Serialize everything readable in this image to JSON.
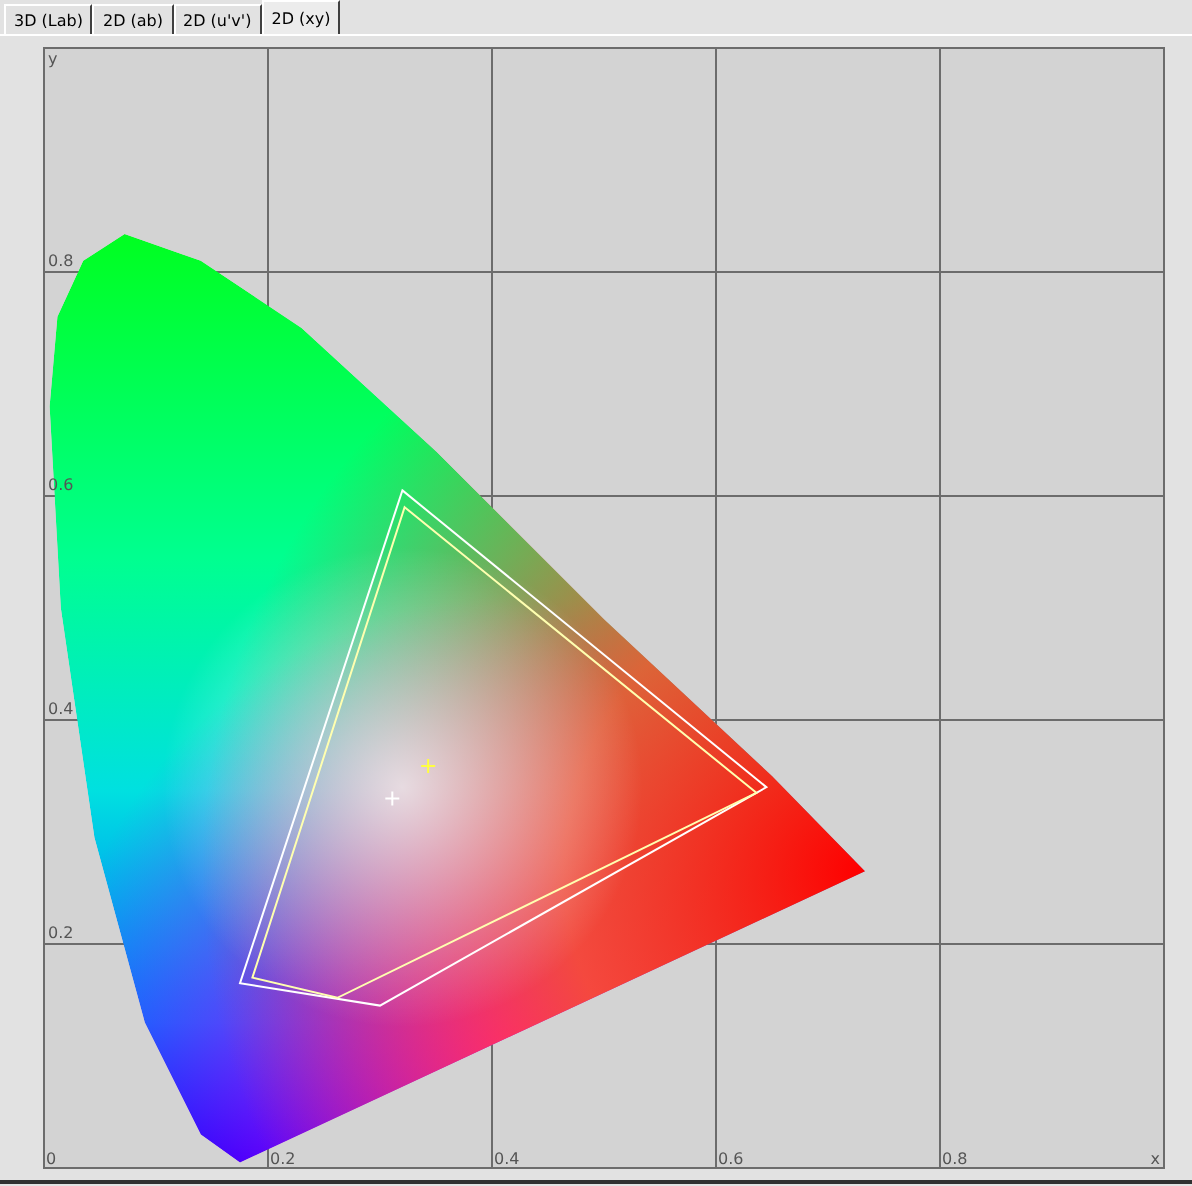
{
  "tabs": [
    {
      "label": "3D (Lab)",
      "selected": false
    },
    {
      "label": "2D (ab)",
      "selected": false
    },
    {
      "label": "2D (u'v')",
      "selected": false
    },
    {
      "label": "2D (xy)",
      "selected": true
    }
  ],
  "plot": {
    "x_axis_label": "x",
    "y_axis_label": "y",
    "x_tick_labels": [
      "0",
      "0.2",
      "0.4",
      "0.6",
      "0.8"
    ],
    "y_tick_labels": [
      "0.8",
      "0.6",
      "0.4",
      "0.2"
    ]
  }
}
